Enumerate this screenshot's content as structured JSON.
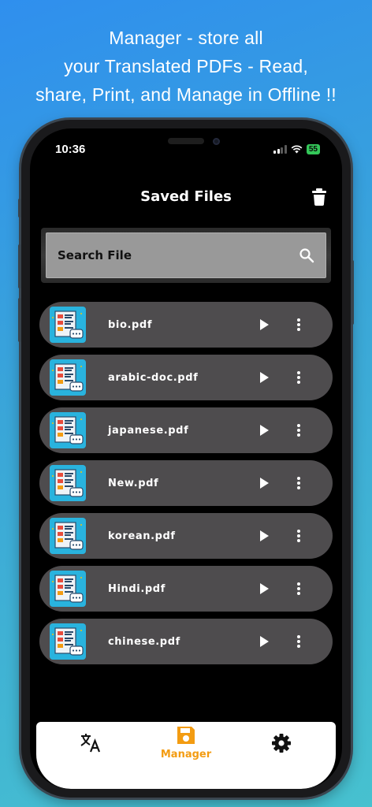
{
  "headline": {
    "line1": "Manager - store all",
    "line2": "your Translated PDFs - Read,",
    "line3": "share, Print, and Manage in Offline !!"
  },
  "status_bar": {
    "time": "10:36",
    "battery": "55"
  },
  "header": {
    "title": "Saved Files",
    "delete_icon": "trash-icon"
  },
  "search": {
    "label": "Search File",
    "icon": "search-icon"
  },
  "files": [
    {
      "name": "bio.pdf"
    },
    {
      "name": "arabic-doc.pdf"
    },
    {
      "name": "japanese.pdf"
    },
    {
      "name": "New.pdf"
    },
    {
      "name": "korean.pdf"
    },
    {
      "name": "Hindi.pdf"
    },
    {
      "name": "chinese.pdf"
    }
  ],
  "bottom_nav": {
    "active": "manager",
    "items": [
      {
        "id": "translate",
        "icon": "translate-icon",
        "label": ""
      },
      {
        "id": "manager",
        "icon": "save-icon",
        "label": "Manager"
      },
      {
        "id": "settings",
        "icon": "gear-icon",
        "label": ""
      }
    ]
  },
  "colors": {
    "accent": "#f39c12",
    "row_bg": "#4e4c4e",
    "thumb_bg": "#29b3de",
    "battery": "#34c759"
  }
}
